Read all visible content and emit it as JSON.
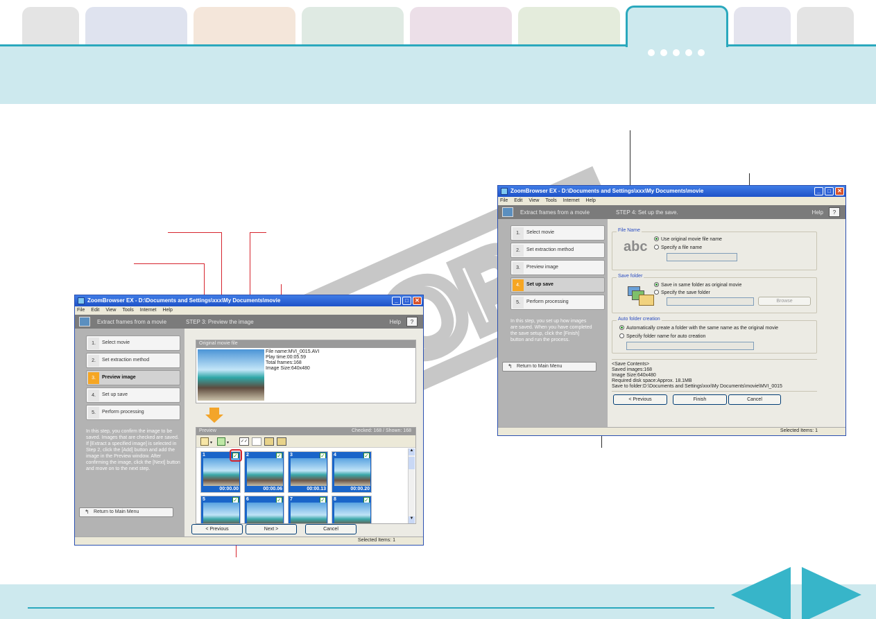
{
  "colors": {
    "accent": "#2aa8bd",
    "band": "#cde9ee",
    "callout": "#d6232c",
    "highlight": "#f6a623"
  },
  "nav": {
    "prev_icon": "triangle-left-icon",
    "next_icon": "triangle-right-icon"
  },
  "win1": {
    "title": "ZoomBrowser EX  -  D:\\Documents and Settings\\xxx\\My Documents\\movie",
    "menu": [
      "File",
      "Edit",
      "View",
      "Tools",
      "Internet",
      "Help"
    ],
    "header_left": "Extract frames from a movie",
    "header_step": "STEP 3: Preview the image",
    "help": "Help",
    "help_btn": "?",
    "steps": [
      {
        "num": "1.",
        "label": "Select movie"
      },
      {
        "num": "2.",
        "label": "Set extraction method"
      },
      {
        "num": "3.",
        "label": "Preview image"
      },
      {
        "num": "4.",
        "label": "Set up save"
      },
      {
        "num": "5.",
        "label": "Perform processing"
      }
    ],
    "help_text": "In this step, you confirm the image to be saved. Images that are checked are saved. If [Extract a specified image] is selected in Step 2, click the [Add] button and add the image in the Preview window. After confirming the image, click the [Next] button and move on to the next step.",
    "return_btn": "Return to Main Menu",
    "original": {
      "group": "Original movie file",
      "file_name": "File name:MVI_0015.AVI",
      "play_time": "Play time:00:05.59",
      "total_frames": "Total frames:168",
      "image_size": "Image Size:640x480"
    },
    "preview": {
      "label": "Preview",
      "counts": "Checked: 168 / Shown: 168",
      "thumbs": [
        {
          "n": "1",
          "time": "00:00.00"
        },
        {
          "n": "2",
          "time": "00:00.06"
        },
        {
          "n": "3",
          "time": "00:00.13"
        },
        {
          "n": "4",
          "time": "00:00.20"
        },
        {
          "n": "5",
          "time": ""
        },
        {
          "n": "6",
          "time": ""
        },
        {
          "n": "7",
          "time": ""
        },
        {
          "n": "8",
          "time": ""
        }
      ]
    },
    "buttons": {
      "previous": "< Previous",
      "next": "Next >",
      "cancel": "Cancel"
    },
    "status": "Selected Items: 1"
  },
  "win2": {
    "title": "ZoomBrowser EX  -  D:\\Documents and Settings\\xxx\\My Documents\\movie",
    "menu": [
      "File",
      "Edit",
      "View",
      "Tools",
      "Internet",
      "Help"
    ],
    "header_left": "Extract frames from a movie",
    "header_step": "STEP 4: Set up the save.",
    "help": "Help",
    "help_btn": "?",
    "steps": [
      {
        "num": "1.",
        "label": "Select movie"
      },
      {
        "num": "2.",
        "label": "Set extraction method"
      },
      {
        "num": "3.",
        "label": "Preview image"
      },
      {
        "num": "4.",
        "label": "Set up save"
      },
      {
        "num": "5.",
        "label": "Perform processing"
      }
    ],
    "help_text": "In this step, you set up how images are saved. When you have completed the save setup, click the [Finish] button and run the process.",
    "return_btn": "Return to Main Menu",
    "file_name": {
      "group": "File Name",
      "icon_text": "abc",
      "opt1": "Use original movie file name",
      "opt2": "Specify a file name"
    },
    "save_folder": {
      "group": "Save folder",
      "opt1": "Save in same folder as original movie",
      "opt2": "Specify the save folder",
      "browse": "Browse"
    },
    "auto_folder": {
      "group": "Auto folder creation",
      "opt1": "Automatically create a folder with the same name as the original movie",
      "opt2": "Specify folder name for auto creation"
    },
    "contents": [
      "<Save Contents>",
      "Saved images:168",
      "Image Size:640x480",
      "Required disk space:Approx. 18.1MB",
      "Save to folder:D:\\Documents and Settings\\xxx\\My Documents\\movie\\MVI_0015"
    ],
    "buttons": {
      "previous": "< Previous",
      "finish": "Finish",
      "cancel": "Cancel"
    },
    "status": "Selected Items: 1"
  },
  "watermark": "COPY"
}
